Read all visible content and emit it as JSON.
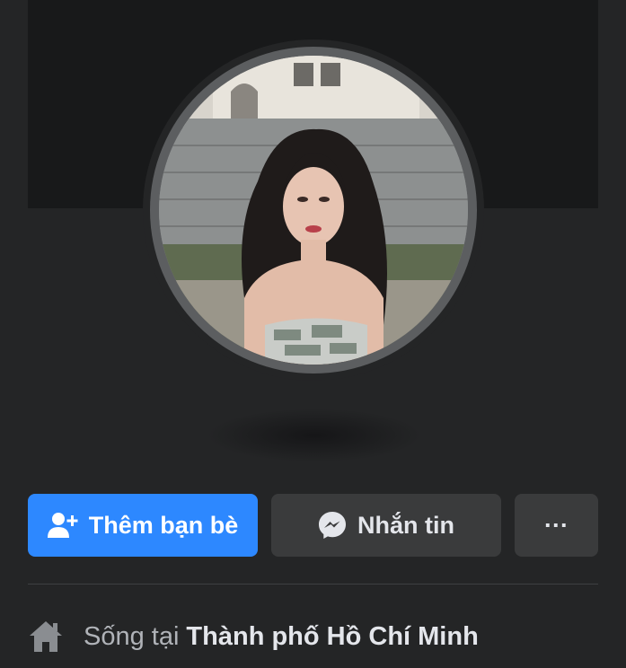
{
  "profile": {
    "avatar_alt": "profile photo"
  },
  "actions": {
    "add_friend_label": "Thêm bạn bè",
    "message_label": "Nhắn tin",
    "more_label": "···"
  },
  "about": {
    "lives_in_prefix": "Sống tại",
    "city": "Thành phố Hồ Chí Minh"
  },
  "colors": {
    "background": "#242526",
    "cover": "#18191a",
    "primary_button": "#2d88ff",
    "secondary_button": "#3a3b3c"
  },
  "icons": {
    "add_friend": "person-add-icon",
    "messenger": "messenger-icon",
    "more": "more-icon",
    "home": "home-icon"
  }
}
